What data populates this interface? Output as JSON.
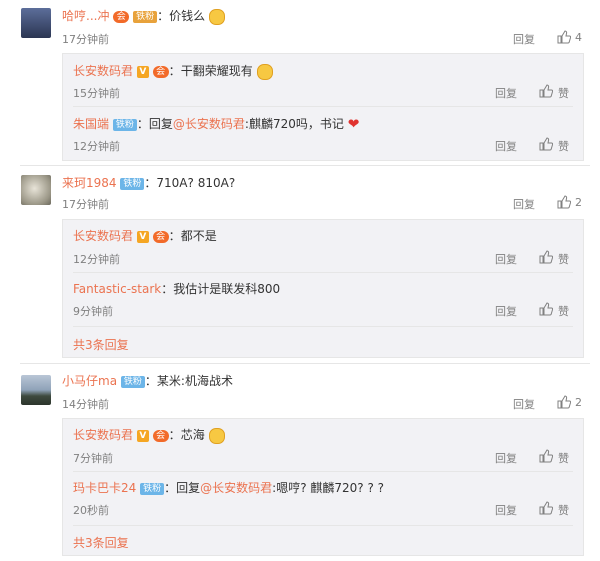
{
  "comments": [
    {
      "user": "哈哼...冲",
      "fans_label": "铁粉",
      "text": "价钱么",
      "time": "17分钟前",
      "reply": "回复",
      "likes": "4",
      "replies": [
        {
          "user": "长安数码君",
          "text": "干翻荣耀现有",
          "time": "15分钟前",
          "reply": "回复",
          "like": "赞"
        },
        {
          "user": "朱国端",
          "fans_label": "铁粉",
          "text_prefix": "回复",
          "mention": "@长安数码君",
          "text": ":麒麟720吗，书记",
          "time": "12分钟前",
          "reply": "回复",
          "like": "赞"
        }
      ]
    },
    {
      "user": "来珂1984",
      "fans_label": "铁粉",
      "text": "710A? 810A?",
      "time": "17分钟前",
      "reply": "回复",
      "likes": "2",
      "replies": [
        {
          "user": "长安数码君",
          "text": "都不是",
          "time": "12分钟前",
          "reply": "回复",
          "like": "赞"
        },
        {
          "user": "Fantastic-stark",
          "text": "我估计是联发科800",
          "time": "9分钟前",
          "reply": "回复",
          "like": "赞"
        }
      ],
      "more": "共3条回复"
    },
    {
      "user": "小马仔ma",
      "fans_label": "铁粉",
      "text": "某米:机海战术",
      "time": "14分钟前",
      "reply": "回复",
      "likes": "2",
      "replies": [
        {
          "user": "长安数码君",
          "text": "芯海",
          "time": "7分钟前",
          "reply": "回复",
          "like": "赞"
        },
        {
          "user": "玛卡巴卡24",
          "fans_label": "铁粉",
          "text_prefix": "回复",
          "mention": "@长安数码君",
          "text": ":嗯哼? 麒麟720? ? ?",
          "time": "20秒前",
          "reply": "回复",
          "like": "赞"
        }
      ],
      "more": "共3条回复"
    }
  ],
  "colors": {
    "username": "#eb7350",
    "meta": "#808080",
    "reply_box": "#f2f2f5"
  },
  "icons": {
    "like": "thumbs-up-icon",
    "vip": "v-verified-icon",
    "member": "member-badge-icon",
    "emoji": "smile-emoji-icon",
    "heart": "heart-emoji-icon"
  }
}
